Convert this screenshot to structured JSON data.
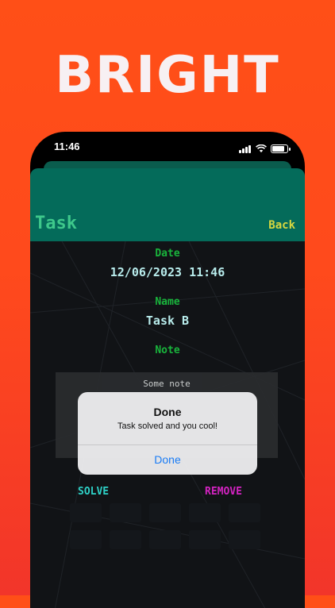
{
  "promo": {
    "headline": "BRIGHT"
  },
  "status_bar": {
    "time": "11:46",
    "icons": [
      "signal-icon",
      "wifi-icon",
      "battery-icon"
    ]
  },
  "nav": {
    "title": "Task",
    "back_label": "Back"
  },
  "task": {
    "date_label": "Date",
    "date_value": "12/06/2023 11:46",
    "name_label": "Name",
    "name_value": "Task B",
    "note_label": "Note",
    "note_value": "Some note"
  },
  "actions": {
    "solve_label": "SOLVE",
    "remove_label": "REMOVE"
  },
  "alert": {
    "title": "Done",
    "message": "Task solved and you cool!",
    "button_label": "Done"
  },
  "colors": {
    "header": "#046b5a",
    "title": "#3ec88b",
    "back": "#d7d740",
    "label_green": "#19b43c",
    "value": "#b8ecec",
    "solve": "#2ed0c6",
    "remove": "#d223c0",
    "alert_button": "#1a7cf5"
  }
}
